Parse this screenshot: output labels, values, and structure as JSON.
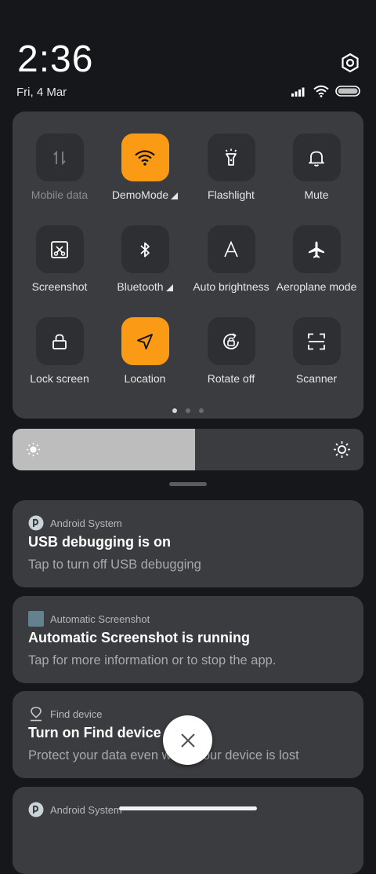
{
  "status": {
    "time": "2:36",
    "date": "Fri, 4 Mar"
  },
  "tiles": [
    {
      "label": "Mobile data",
      "state": "unavailable",
      "icon": "mobile-data-icon"
    },
    {
      "label": "DemoMode",
      "state": "on",
      "icon": "wifi-icon",
      "expandable": true
    },
    {
      "label": "Flashlight",
      "state": "off",
      "icon": "flashlight-icon"
    },
    {
      "label": "Mute",
      "state": "off",
      "icon": "bell-icon"
    },
    {
      "label": "Screenshot",
      "state": "off",
      "icon": "screenshot-icon"
    },
    {
      "label": "Bluetooth",
      "state": "off",
      "icon": "bluetooth-icon",
      "expandable": true
    },
    {
      "label": "Auto brightness",
      "state": "off",
      "icon": "auto-brightness-icon"
    },
    {
      "label": "Aeroplane mode",
      "state": "off",
      "icon": "airplane-icon"
    },
    {
      "label": "Lock screen",
      "state": "off",
      "icon": "lock-icon"
    },
    {
      "label": "Location",
      "state": "on",
      "icon": "location-icon"
    },
    {
      "label": "Rotate off",
      "state": "off",
      "icon": "rotate-lock-icon"
    },
    {
      "label": "Scanner",
      "state": "off",
      "icon": "scanner-icon"
    }
  ],
  "pager": {
    "pages": 3,
    "active": 1
  },
  "brightness": {
    "level": 0.52
  },
  "notifications": [
    {
      "app": "Android System",
      "title": "USB debugging is on",
      "body": "Tap to turn off USB debugging",
      "icon": "android-system-icon"
    },
    {
      "app": "Automatic Screenshot",
      "title": "Automatic Screenshot is running",
      "body": "Tap for more information or to stop the app.",
      "icon": "app-square-icon"
    },
    {
      "app": "Find device",
      "title": "Turn on Find device",
      "body": "Protect your data even when your device is lost",
      "icon": "find-device-icon"
    },
    {
      "app": "Android System",
      "title": "",
      "body": "",
      "icon": "android-system-icon"
    }
  ],
  "colors": {
    "accent": "#fb9a15",
    "panel": "#3b3c3f",
    "background": "#15171b"
  }
}
